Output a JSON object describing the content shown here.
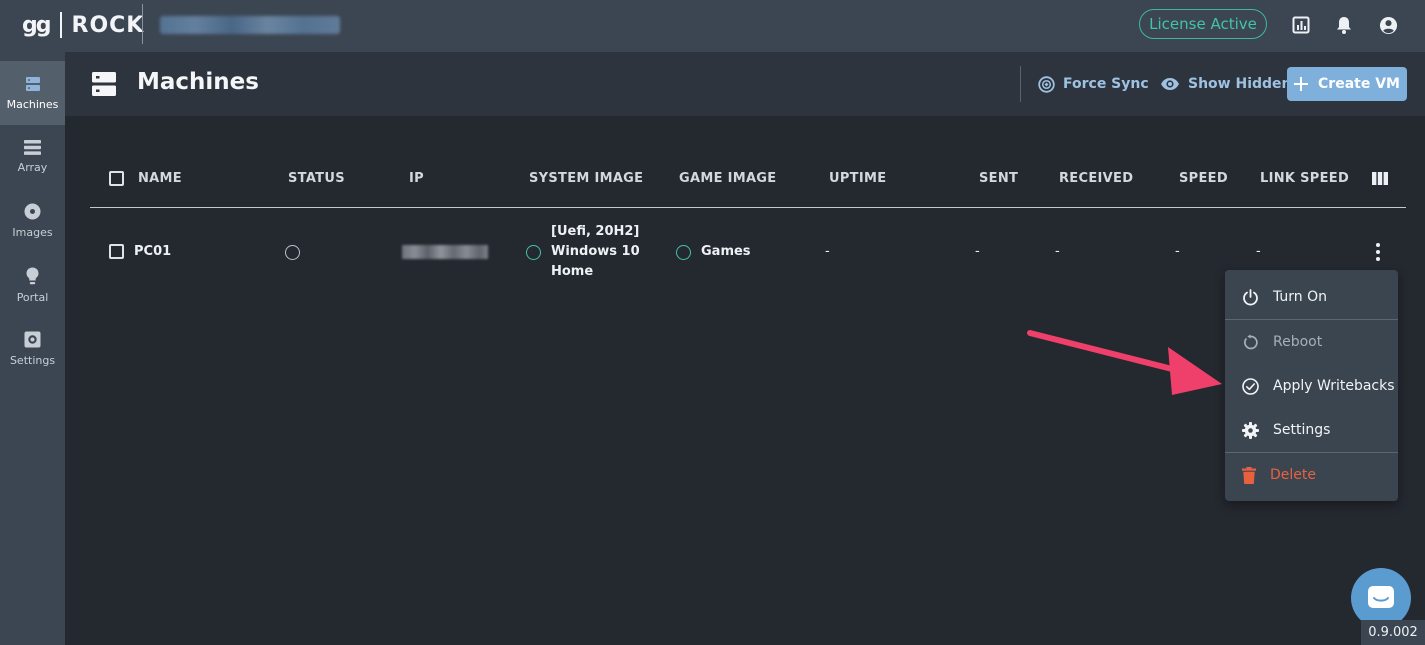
{
  "app": {
    "logo_left": "gg",
    "logo_right": "ROCK",
    "license_label": "License Active",
    "version": "0.9.002"
  },
  "topbar": {
    "icons": [
      "chart-icon",
      "bell-icon",
      "account-icon"
    ]
  },
  "sidebar": {
    "items": [
      {
        "label": "Machines",
        "icon": "server-icon",
        "active": true
      },
      {
        "label": "Array",
        "icon": "list-icon",
        "active": false
      },
      {
        "label": "Images",
        "icon": "disc-icon",
        "active": false
      },
      {
        "label": "Portal",
        "icon": "bulb-icon",
        "active": false
      },
      {
        "label": "Settings",
        "icon": "gear-box-icon",
        "active": false
      }
    ]
  },
  "header": {
    "title": "Machines",
    "force_sync": "Force Sync",
    "show_hidden": "Show Hidden",
    "create_vm": "Create VM"
  },
  "table": {
    "columns": [
      "NAME",
      "STATUS",
      "IP",
      "SYSTEM IMAGE",
      "GAME IMAGE",
      "UPTIME",
      "SENT",
      "RECEIVED",
      "SPEED",
      "LINK SPEED"
    ],
    "rows": [
      {
        "name": "PC01",
        "system_image_line1": "[Uefi, 20H2]",
        "system_image_line2": "Windows 10",
        "system_image_line3": "Home",
        "game_image": "Games",
        "uptime": "-",
        "sent": "-",
        "received": "-",
        "speed": "-",
        "link_speed": "-"
      }
    ]
  },
  "menu": {
    "turn_on": "Turn On",
    "reboot": "Reboot",
    "apply_writebacks": "Apply Writebacks",
    "settings": "Settings",
    "delete": "Delete"
  },
  "colors": {
    "accent_blue": "#7fb0dc",
    "license_green": "#43c4a4",
    "danger": "#e8613f",
    "annotation_arrow": "#ef3f6b"
  }
}
